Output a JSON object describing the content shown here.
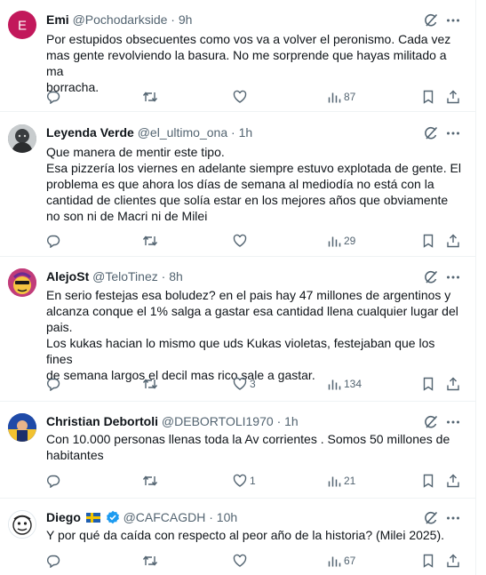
{
  "tweets": [
    {
      "name": "Emi",
      "handle": "@Pochodarkside",
      "time": "9h",
      "avatar_letter": "E",
      "avatar_color": "#c2185b",
      "lines": [
        "Por estupidos obsecuentes como vos va a volver el peronismo. Cada vez",
        "mas gente revolviendo la basura. No me sorprende que hayas militado a ma",
        "borracha."
      ],
      "replies": "",
      "reposts": "",
      "likes": "",
      "views": "87"
    },
    {
      "name": "Leyenda Verde",
      "handle": "@el_ultimo_ona",
      "time": "1h",
      "avatar_icon": "portrait-photo-icon",
      "lines": [
        "Que manera de mentir este tipo.",
        "Esa pizzería los viernes en adelante siempre estuvo explotada de gente. El",
        "problema es que ahora los días de semana al mediodía no está con la",
        "cantidad de clientes que solía estar en los mejores años que obviamente",
        "no son ni de Macri ni de Milei"
      ],
      "replies": "",
      "reposts": "",
      "likes": "",
      "views": "29"
    },
    {
      "name": "AlejoSt",
      "handle": "@TeloTinez",
      "time": "8h",
      "avatar_icon": "cartoon-character-icon",
      "lines": [
        "En serio festejas esa boludez? en el pais hay 47 millones de argentinos y",
        "alcanza conque el 1% salga a gastar esa cantidad llena cualquier lugar del",
        "pais.",
        "Los kukas hacian lo mismo que uds Kukas violetas, festejaban que los fines",
        "de semana largos el decil mas rico sale a gastar."
      ],
      "replies": "",
      "reposts": "",
      "likes": "3",
      "views": "134"
    },
    {
      "name": "Christian Debortoli",
      "handle": "@DEBORTOLI1970",
      "time": "1h",
      "avatar_icon": "blue-yellow-photo-icon",
      "lines": [
        "Con 10.000 personas llenas toda la Av corrientes . Somos 50 millones de",
        "habitantes"
      ],
      "replies": "",
      "reposts": "",
      "likes": "1",
      "views": "21"
    },
    {
      "name": "Diego",
      "handle": "@CAFCAGDH",
      "time": "10h",
      "avatar_icon": "sketch-face-icon",
      "flag_icon": "sweden-flag-icon",
      "verified": true,
      "lines": [
        "Y por qué da caída con respecto al peor año de la historia? (Milei 2025)."
      ],
      "replies": "",
      "reposts": "",
      "likes": "",
      "views": "67"
    }
  ],
  "colors": {
    "text": "#0f1419",
    "secondary": "#536471",
    "border": "#eff3f4",
    "verified": "#1d9bf0"
  }
}
